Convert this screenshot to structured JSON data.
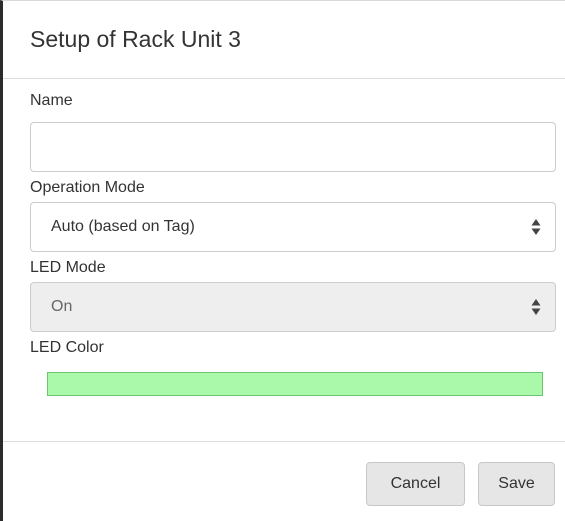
{
  "dialog": {
    "title": "Setup of Rack Unit 3"
  },
  "form": {
    "name": {
      "label": "Name",
      "value": "",
      "placeholder": ""
    },
    "operation_mode": {
      "label": "Operation Mode",
      "selected": "Auto (based on Tag)"
    },
    "led_mode": {
      "label": "LED Mode",
      "selected": "On",
      "disabled": true
    },
    "led_color": {
      "label": "LED Color",
      "color": "#aaf8aa"
    }
  },
  "footer": {
    "cancel_label": "Cancel",
    "save_label": "Save"
  },
  "icons": {
    "select_arrows": "up-down-arrows-icon"
  }
}
